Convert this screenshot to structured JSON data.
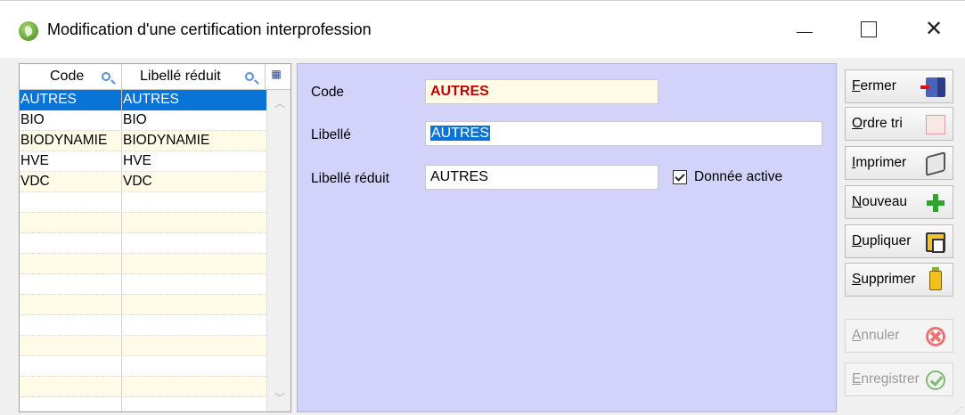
{
  "window": {
    "title": "Modification d'une certification interprofession",
    "min_icon": "minimize-icon",
    "max_icon": "maximize-icon",
    "close_glyph": "✕"
  },
  "grid": {
    "columns": [
      "Code",
      "Libellé réduit"
    ],
    "rows": [
      {
        "code": "AUTRES",
        "libelle": "AUTRES",
        "selected": true
      },
      {
        "code": "BIO",
        "libelle": "BIO"
      },
      {
        "code": "BIODYNAMIE",
        "libelle": "BIODYNAMIE"
      },
      {
        "code": "HVE",
        "libelle": "HVE"
      },
      {
        "code": "VDC",
        "libelle": "VDC"
      }
    ],
    "empty_rows": 10
  },
  "form": {
    "code_label": "Code",
    "code_value": "AUTRES",
    "libelle_label": "Libellé",
    "libelle_value": "AUTRES",
    "libelle_reduit_label": "Libellé réduit",
    "libelle_reduit_value": "AUTRES",
    "active_label": "Donnée active",
    "active_checked": true
  },
  "buttons": [
    {
      "label": "Fermer",
      "icon": "exit-door-icon",
      "enabled": true
    },
    {
      "label": "Ordre tri",
      "icon": "sort-order-icon",
      "enabled": true
    },
    {
      "label": "Imprimer",
      "icon": "printer-icon",
      "enabled": true
    },
    {
      "label": "Nouveau",
      "icon": "plus-icon",
      "enabled": true
    },
    {
      "label": "Dupliquer",
      "icon": "duplicate-icon",
      "enabled": true
    },
    {
      "label": "Supprimer",
      "icon": "trash-icon",
      "enabled": true
    },
    {
      "label": "Annuler",
      "icon": "cancel-icon",
      "enabled": false
    },
    {
      "label": "Enregistrer",
      "icon": "save-check-icon",
      "enabled": false
    }
  ],
  "colors": {
    "selection": "#0a74d6",
    "form_bg": "#d2d2fa",
    "code_text": "#c00000",
    "alt_row": "#fffbe6"
  }
}
